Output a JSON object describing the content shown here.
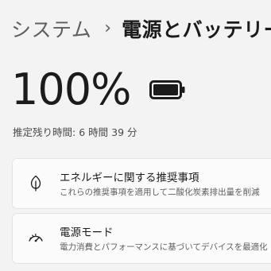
{
  "header": {
    "breadcrumb_parent": "システム",
    "breadcrumb_separator": "›",
    "breadcrumb_current": "電源とバッテリー"
  },
  "battery": {
    "percent_text": "100%",
    "level": 1.0,
    "icon": "battery-full-icon",
    "remaining_label": "推定残り時間:",
    "remaining_value": "6 時間 39 分"
  },
  "cards": [
    {
      "icon": "leaf-icon",
      "title": "エネルギーに関する推奨事項",
      "subtitle": "これらの推奨事項を適用して二酸化炭素排出量を削減"
    },
    {
      "icon": "power-mode-gauge-icon",
      "title": "電源モード",
      "subtitle": "電力消費とパフォーマンスに基づいてデバイスを最適化"
    }
  ],
  "colors": {
    "background": "#f3f3f3",
    "card_background": "#fbfbfb",
    "text_primary": "#1b1b1b",
    "text_secondary": "#5f5f5f"
  }
}
